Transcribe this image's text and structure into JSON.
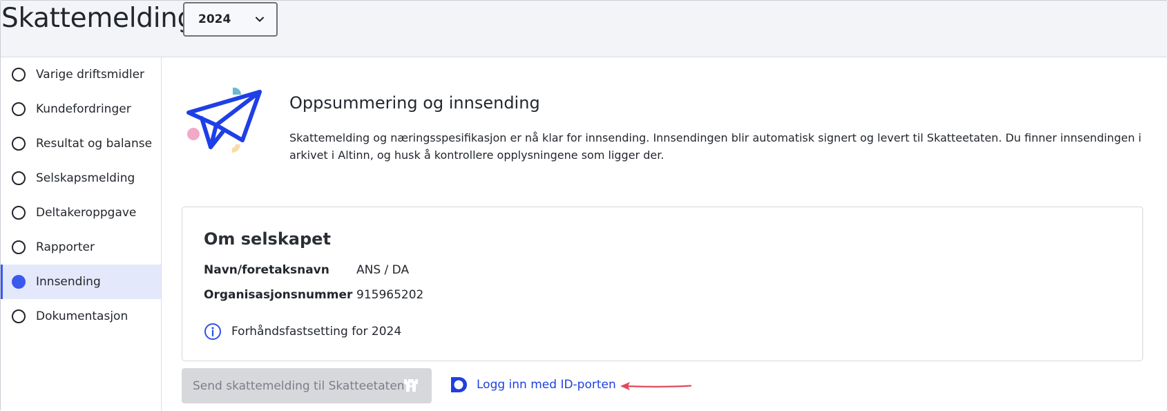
{
  "header": {
    "title": "Skattemelding",
    "year_select": {
      "value": "2024"
    }
  },
  "sidebar": {
    "items": [
      {
        "label": "Varige driftsmidler",
        "active": false
      },
      {
        "label": "Kundefordringer",
        "active": false
      },
      {
        "label": "Resultat og balanse",
        "active": false
      },
      {
        "label": "Selskapsmelding",
        "active": false
      },
      {
        "label": "Deltakeroppgave",
        "active": false
      },
      {
        "label": "Rapporter",
        "active": false
      },
      {
        "label": "Innsending",
        "active": true
      },
      {
        "label": "Dokumentasjon",
        "active": false
      }
    ]
  },
  "summary": {
    "icon": "paper-plane-icon",
    "title": "Oppsummering og innsending",
    "text": "Skattemelding og næringsspesifikasjon er nå klar for innsending. Innsendingen blir automatisk signert og levert til Skatteetaten. Du finner innsendingen i arkivet i Altinn, og husk å kontrollere opplysningene som ligger der."
  },
  "company": {
    "title": "Om selskapet",
    "rows": [
      {
        "label": "Navn/foretaksnavn",
        "value": "ANS / DA"
      },
      {
        "label": "Organisasjonsnummer",
        "value": "915965202"
      }
    ],
    "info": {
      "icon": "info-icon",
      "text": "Forhåndsfastsetting for 2024"
    }
  },
  "actions": {
    "send_label": "Send skattemelding til Skatteetaten",
    "send_icon": "castle-icon",
    "login_label": "Logg inn med ID-porten",
    "login_icon": "id-porten-icon"
  },
  "colors": {
    "accent": "#3b59ee",
    "link": "#1e3fe0",
    "active_bg": "#e4e8fb",
    "annotation_arrow": "#e2485b"
  }
}
